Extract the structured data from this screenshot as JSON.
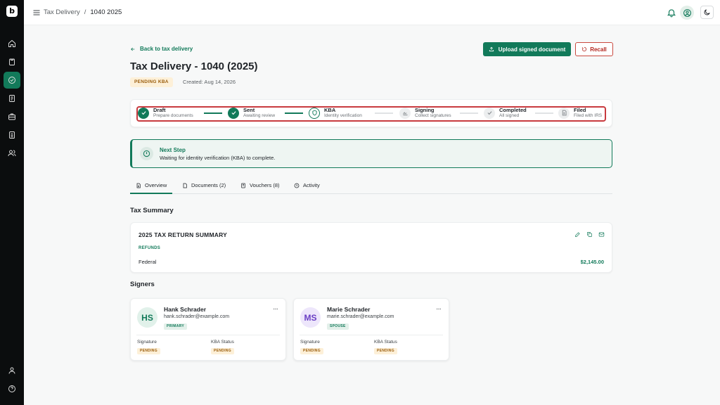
{
  "breadcrumb": [
    "Tax Delivery",
    "1040 2025"
  ],
  "breadcrumb_separator": "/",
  "back_label": "Back to tax delivery",
  "title": "Tax Delivery - 1040 (2025)",
  "status": "PENDING KBA",
  "created": "Created: Aug 14, 2026",
  "actions": {
    "upload": "Upload signed document",
    "recall": "Recall"
  },
  "steps": [
    {
      "name": "Draft",
      "desc": "Prepare documents",
      "state": "done",
      "icon": "check-icon"
    },
    {
      "name": "Sent",
      "desc": "Awaiting review",
      "state": "done",
      "icon": "check-icon"
    },
    {
      "name": "KBA",
      "desc": "Identity verification",
      "state": "current",
      "icon": "shield-icon"
    },
    {
      "name": "Signing",
      "desc": "Collect signatures",
      "state": "todo",
      "icon": "signature-icon"
    },
    {
      "name": "Completed",
      "desc": "All signed",
      "state": "todo",
      "icon": "check-icon"
    },
    {
      "name": "Filed",
      "desc": "Filed with IRS",
      "state": "todo",
      "icon": "document-icon"
    }
  ],
  "next_step": {
    "title": "Next Step",
    "text": "Waiting for identity verification (KBA) to complete."
  },
  "tabs": [
    {
      "label": "Overview",
      "icon": "document-icon",
      "active": true
    },
    {
      "label": "Documents (2)",
      "icon": "file-icon",
      "active": false
    },
    {
      "label": "Vouchers (8)",
      "icon": "voucher-icon",
      "active": false
    },
    {
      "label": "Activity",
      "icon": "clock-icon",
      "active": false
    }
  ],
  "tax_summary": {
    "heading": "Tax Summary",
    "card_title": "2025 TAX RETURN SUMMARY",
    "refunds_label": "REFUNDS",
    "federal_label": "Federal",
    "federal_amount": "$2,145.00"
  },
  "signers_heading": "Signers",
  "signers": [
    {
      "initials": "HS",
      "name": "Hank Schrader",
      "email": "hank.schrader@example.com",
      "role": "PRIMARY",
      "signature_label": "Signature",
      "signature_status": "PENDING",
      "kba_label": "KBA Status",
      "kba_status": "PENDING",
      "avatar_bg": "#e1f1ea",
      "avatar_color": "#127a5a"
    },
    {
      "initials": "MS",
      "name": "Marie Schrader",
      "email": "marie.schrader@example.com",
      "role": "SPOUSE",
      "signature_label": "Signature",
      "signature_status": "PENDING",
      "kba_label": "KBA Status",
      "kba_status": "PENDING",
      "avatar_bg": "#ede6fb",
      "avatar_color": "#6a3fc4"
    }
  ],
  "more_glyph": "···",
  "colors": {
    "brand": "#127a5a",
    "danger": "#b3261e",
    "warning_bg": "#fdf0d8",
    "warning_text": "#9a5d0c"
  }
}
